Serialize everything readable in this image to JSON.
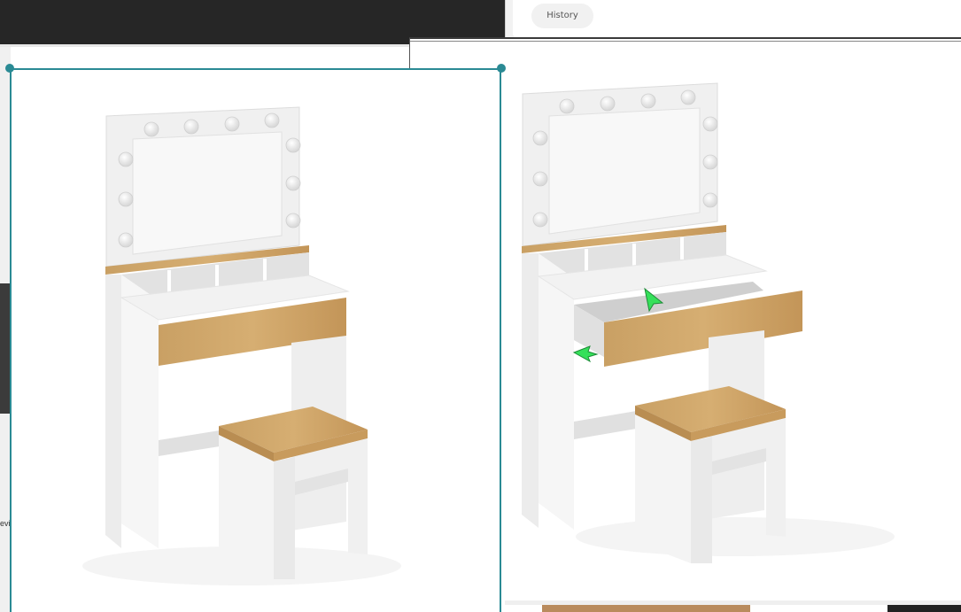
{
  "toolbar": {
    "history_label": "History",
    "fragment_text": "evi"
  },
  "images": {
    "left": "vanity-table-with-closed-drawer",
    "right": "vanity-table-with-open-drawer"
  },
  "colors": {
    "selection_border": "#2a8a94",
    "wood": "#c79a5e",
    "white_board": "#f2f2f2",
    "cursor_green": "#35e05a"
  }
}
